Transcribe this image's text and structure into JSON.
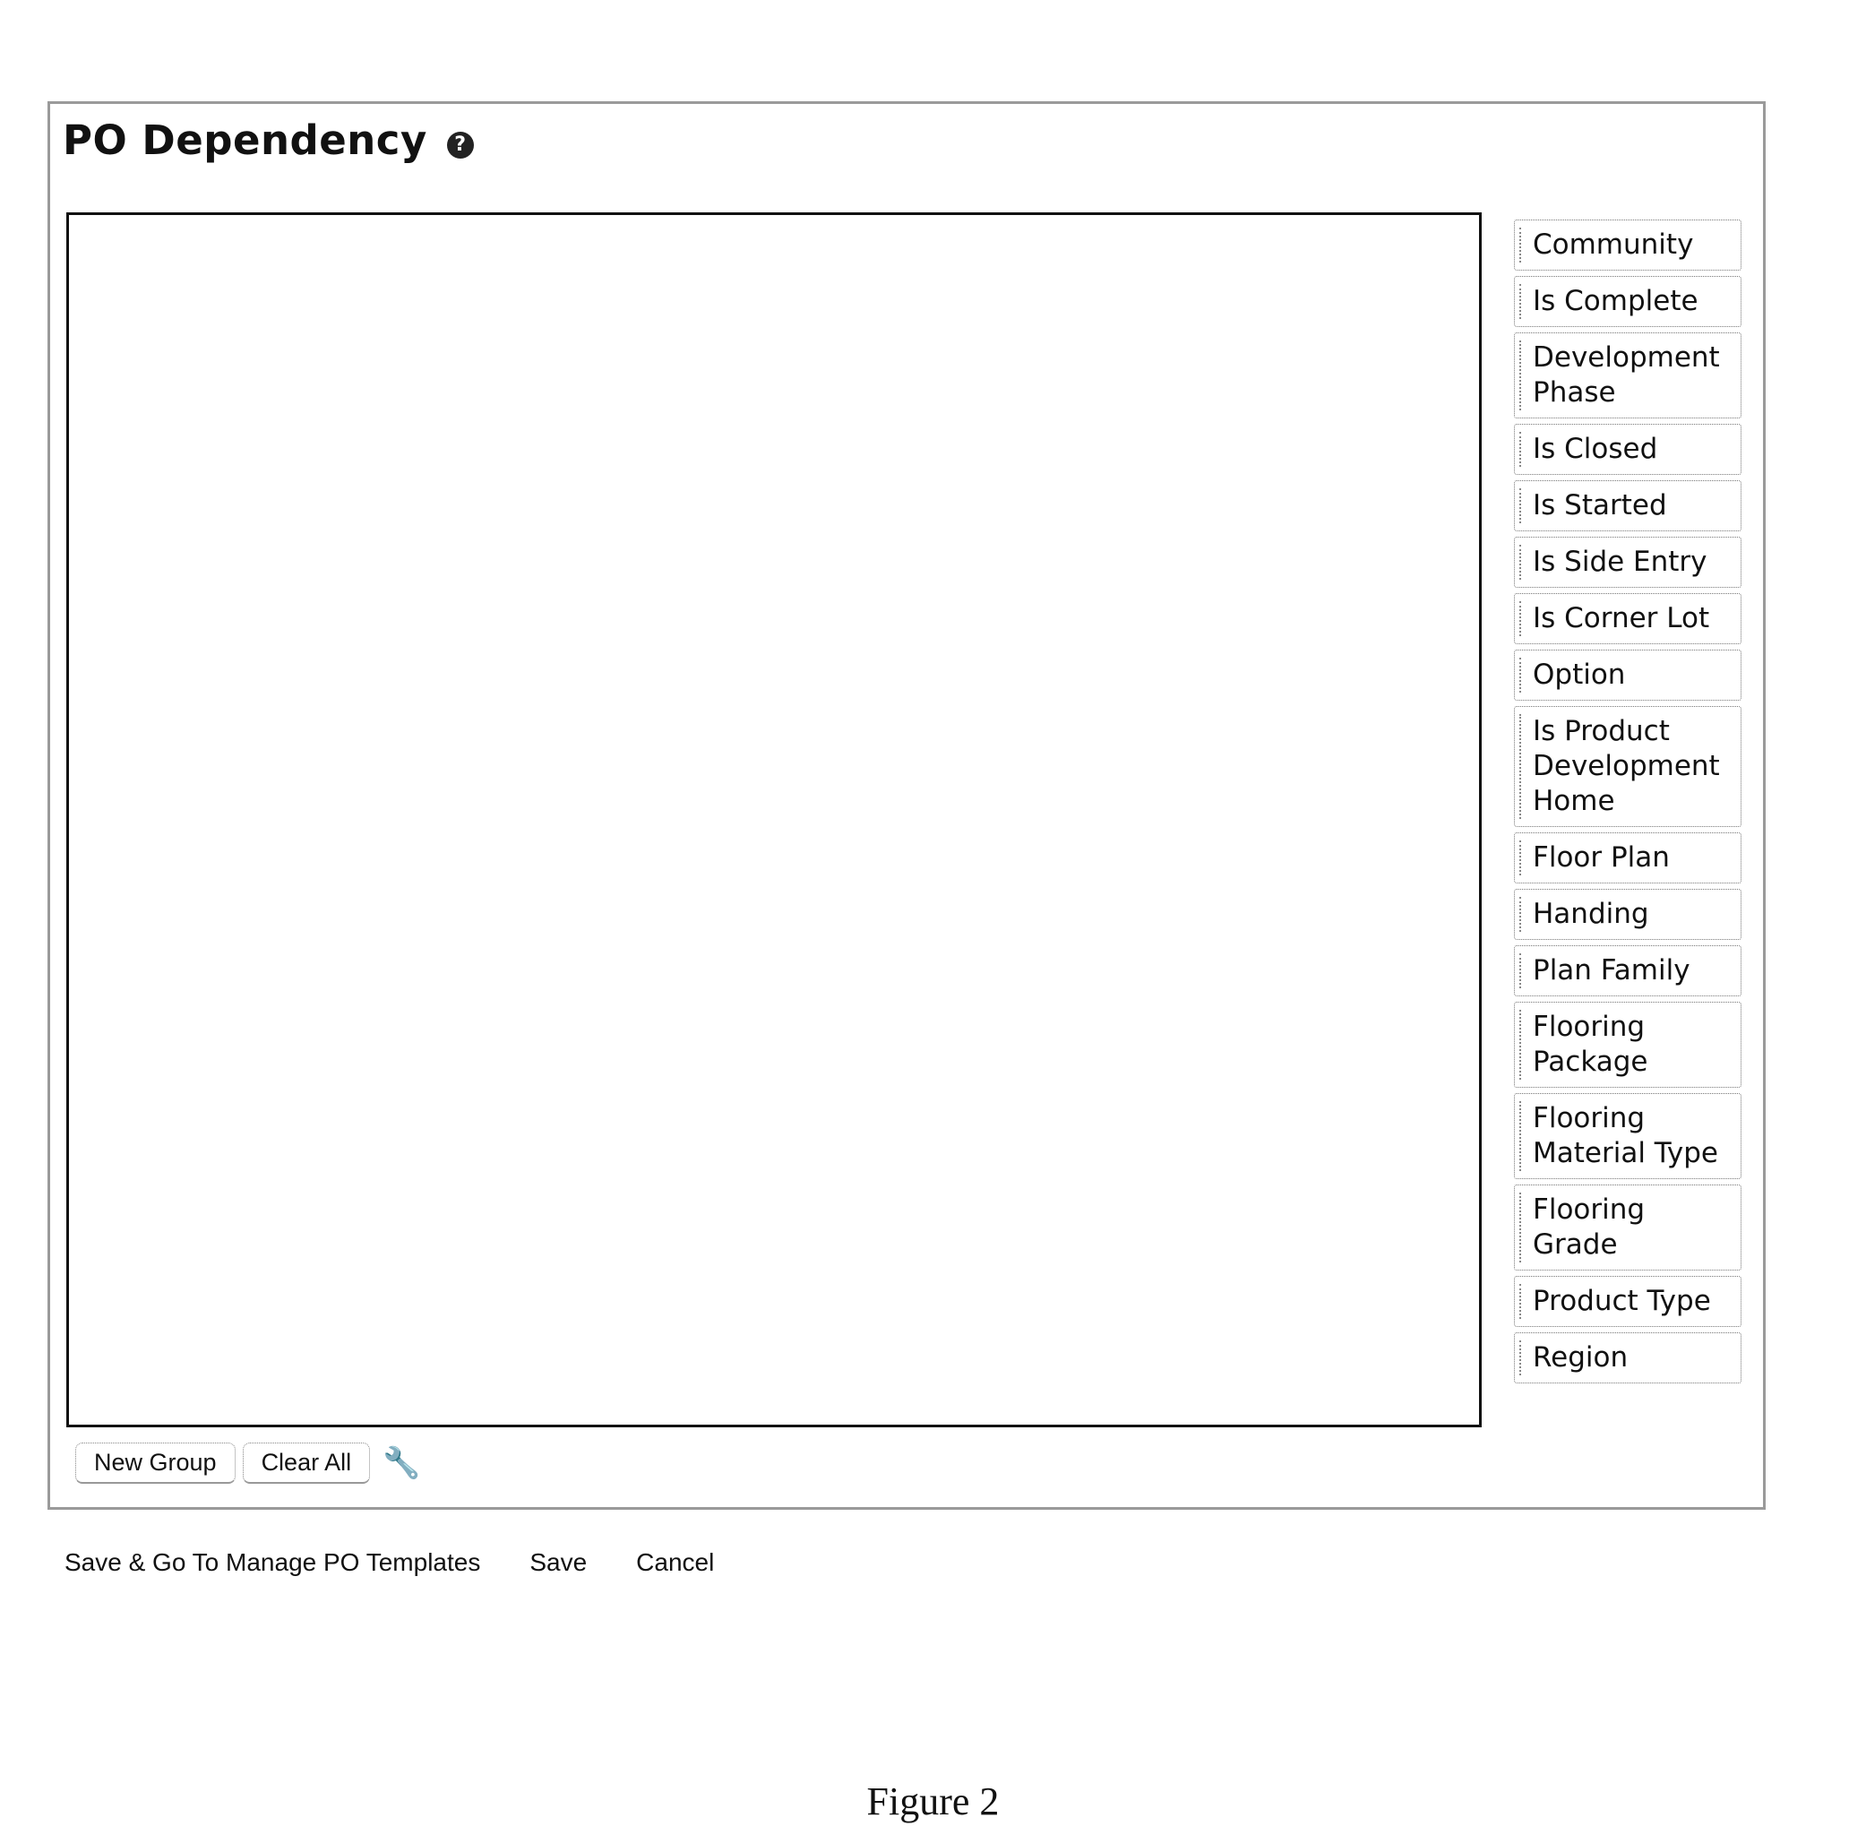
{
  "header": {
    "title": "PO Dependency",
    "help_icon": "?"
  },
  "fields": [
    "Community",
    "Is Complete",
    "Development Phase",
    "Is Closed",
    "Is Started",
    "Is Side Entry",
    "Is Corner Lot",
    "Option",
    "Is Product Development Home",
    "Floor Plan",
    "Handing",
    "Plan Family",
    "Flooring Package",
    "Flooring Material Type",
    "Flooring Grade",
    "Product Type",
    "Region"
  ],
  "toolbar": {
    "new_group": "New Group",
    "clear_all": "Clear All",
    "wrench_icon": "🔧"
  },
  "actions": {
    "save_go": "Save & Go To Manage PO Templates",
    "save": "Save",
    "cancel": "Cancel"
  },
  "caption": "Figure 2"
}
